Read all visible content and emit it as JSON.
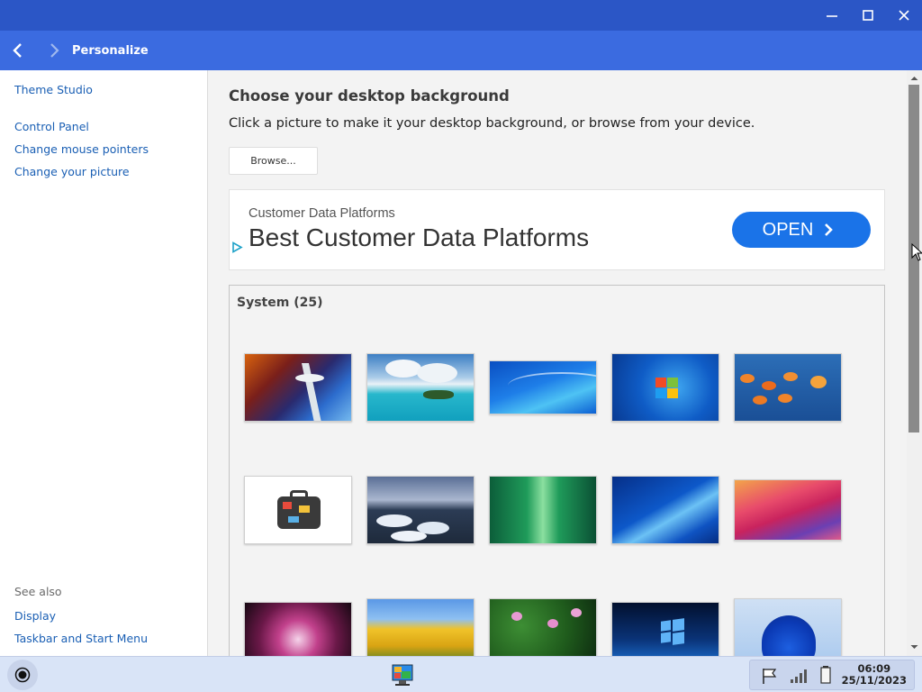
{
  "window": {
    "title": "Personalize",
    "controls": {
      "minimize": "minimize-icon",
      "maximize": "maximize-icon",
      "close": "close-icon"
    }
  },
  "sidebar": {
    "top_links": [
      "Theme Studio",
      "Control Panel",
      "Change mouse pointers",
      "Change your picture"
    ],
    "see_also_label": "See also",
    "see_also_links": [
      "Display",
      "Taskbar and Start Menu"
    ]
  },
  "main": {
    "heading": "Choose your desktop background",
    "subheading": "Click a picture to make it your desktop background, or browse from your device.",
    "browse_label": "Browse..."
  },
  "ad": {
    "small_text": "Customer Data Platforms",
    "big_text": "Best Customer Data Platforms",
    "button_label": "OPEN",
    "button_icon": "chevron-right-icon"
  },
  "gallery": {
    "group_label": "System (25)",
    "thumbnails": [
      "space-needle",
      "tropical-island",
      "blue-swoosh",
      "windows-7-logo",
      "goldfish",
      "suitcase",
      "glacier-lake",
      "green-aurora",
      "blue-light-streak",
      "red-waves",
      "purple-dahlia",
      "yellow-tulips",
      "water-lilies",
      "windows-10-light",
      "windows-11-bloom"
    ]
  },
  "taskbar": {
    "time": "06:09",
    "date": "25/11/2023",
    "tray_icons": [
      "flag-icon",
      "signal-icon",
      "battery-icon"
    ]
  }
}
